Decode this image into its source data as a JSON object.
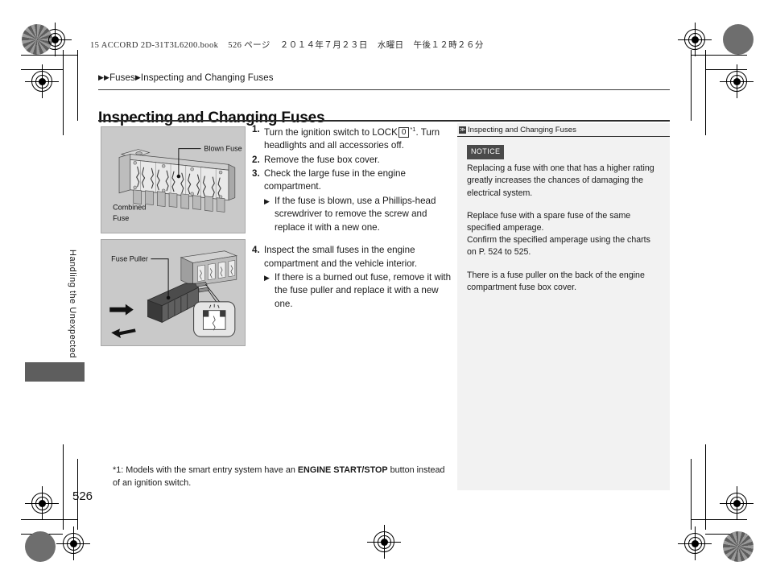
{
  "file_header": {
    "book": "15 ACCORD 2D-31T3L6200.book",
    "page_ref": "526 ページ",
    "date": "２０１４年７月２３日",
    "weekday": "水曜日",
    "time": "午後１２時２６分"
  },
  "breadcrumb": {
    "arrow1": "▶",
    "arrow2": "▶",
    "parent": "Fuses",
    "arrow3": "▶",
    "current": "Inspecting and Changing Fuses"
  },
  "page_title": "Inspecting and Changing Fuses",
  "side_label": "Handling the Unexpected",
  "page_number": "526",
  "figures": {
    "combined_fuse": {
      "name": "combined-fuse-illustration",
      "callout_top": "Blown Fuse",
      "callout_bottom_line1": "Combined",
      "callout_bottom_line2": "Fuse"
    },
    "fuse_puller": {
      "name": "fuse-puller-illustration",
      "callout": "Fuse Puller"
    }
  },
  "steps": [
    {
      "num": "1.",
      "text_before": "Turn the ignition switch to LOCK",
      "lock_symbol": "0",
      "footnote_mark": "*1",
      "text_after": ". Turn headlights and all accessories off.",
      "substeps": []
    },
    {
      "num": "2.",
      "text_before": "Remove the fuse box cover.",
      "lock_symbol": "",
      "footnote_mark": "",
      "text_after": "",
      "substeps": []
    },
    {
      "num": "3.",
      "text_before": "Check the large fuse in the engine compartment.",
      "lock_symbol": "",
      "footnote_mark": "",
      "text_after": "",
      "substeps": [
        {
          "arrow": "▶",
          "text": "If the fuse is blown, use a Phillips-head screwdriver to remove the screw and replace it with a new one."
        }
      ]
    },
    {
      "num": "4.",
      "text_before": "Inspect the small fuses in the engine compartment and the vehicle interior.",
      "lock_symbol": "",
      "footnote_mark": "",
      "text_after": "",
      "substeps": [
        {
          "arrow": "▶",
          "text": "If there is a burned out fuse, remove it with the fuse puller and replace it with a new one."
        }
      ]
    }
  ],
  "footnote": {
    "prefix": "*1: Models with the smart entry system have an ",
    "bold": "ENGINE START/STOP",
    "suffix": " button instead of an ignition switch."
  },
  "sidebar": {
    "header_glyph": "≫",
    "header_title": "Inspecting and Changing Fuses",
    "notice_tag": "NOTICE",
    "paragraphs": [
      "Replacing a fuse with one that has a higher rating greatly increases the chances of damaging the electrical system.",
      "Replace fuse with a spare fuse of the same specified amperage.\nConfirm the specified amperage using the charts on P. 524 to 525.",
      "There is a fuse puller on the back of the engine compartment fuse box cover."
    ]
  },
  "colors": {
    "figure_background": "#c9c9c9",
    "sidebar_background": "#f2f2f2",
    "side_tab": "#5e5e5e",
    "notice_tag": "#4a4a4a"
  }
}
